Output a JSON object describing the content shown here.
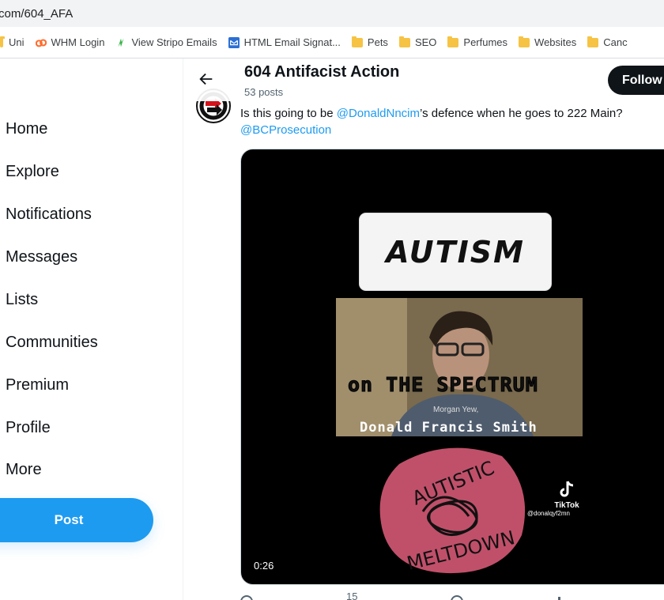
{
  "browser": {
    "url": "com/604_AFA",
    "bookmarks": [
      {
        "label": "Uni",
        "icon": "folder-icon"
      },
      {
        "label": "WHM Login",
        "icon": "cpanel-icon"
      },
      {
        "label": "View Stripo Emails",
        "icon": "stripo-icon"
      },
      {
        "label": "HTML Email Signat...",
        "icon": "email-signature-icon"
      },
      {
        "label": "Pets",
        "icon": "folder-icon"
      },
      {
        "label": "SEO",
        "icon": "folder-icon"
      },
      {
        "label": "Perfumes",
        "icon": "folder-icon"
      },
      {
        "label": "Websites",
        "icon": "folder-icon"
      },
      {
        "label": "Canc",
        "icon": "folder-icon"
      }
    ]
  },
  "sidebar": {
    "items": [
      {
        "label": "Home"
      },
      {
        "label": "Explore"
      },
      {
        "label": "Notifications"
      },
      {
        "label": "Messages"
      },
      {
        "label": "Lists"
      },
      {
        "label": "Communities"
      },
      {
        "label": "Premium"
      },
      {
        "label": "Profile"
      },
      {
        "label": "More"
      }
    ],
    "post_label": "Post"
  },
  "header": {
    "title": "604 Antifacist Action",
    "post_count": "53 posts",
    "follow_label": "Follow"
  },
  "tweet": {
    "text_before": "Is this going to be ",
    "mention_1": "@DonaldNncim",
    "text_after": "’s defence when he goes to 222 Main?",
    "mention_2": "@BCProsecution",
    "media": {
      "headline": "AUTISM",
      "caption": "on THE SPECTRUM",
      "credit_small": "Morgan Yew,",
      "credit_name": "Donald Francis Smith",
      "sticker_top": "AUTISTIC",
      "sticker_bottom": "MELTDOWN",
      "tiktok_label": "TikTok",
      "tiktok_user": "@donalqyf2mn",
      "duration": "0:26"
    },
    "actions_partial": [
      "",
      "15",
      "",
      ""
    ]
  },
  "colors": {
    "accent": "#1d9bf0",
    "dark": "#0f1419",
    "sticker": "#c0506a"
  }
}
